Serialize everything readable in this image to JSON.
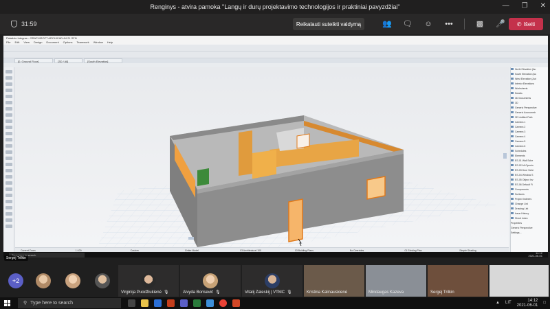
{
  "window": {
    "title": "Renginys - atvira pamoka \"Langų ir durų projektavimo technologijos ir praktiniai pavyzdžiai\""
  },
  "meeting": {
    "timer": "31:59",
    "request_control_label": "Reikalauti suteikti valdymą",
    "leave_label": "Išeiti"
  },
  "archicad": {
    "title": "Paladzio Integras - GRAPHISOFT ARCHICAD-64 21 SFN",
    "menu": [
      "File",
      "Edit",
      "View",
      "Design",
      "Document",
      "Options",
      "Teamwork",
      "Window",
      "Help"
    ],
    "tabs": [
      "[0. Ground Floor]",
      "[3D / All]",
      "[South Elevation]"
    ],
    "navigator": [
      "North Elevation (Au",
      "South Elevation (Au",
      "West Elevation (Aut",
      "Interior Elevations",
      "Worksheets",
      "Details",
      "3D Documents",
      "3D",
      "Generic Perspective",
      "Generic Axonometr",
      "3D Untitled Path",
      "Camera 1",
      "Camera 2",
      "Camera 3",
      "Camera 4",
      "Camera 5",
      "Camera 6",
      "Schedules",
      "Elements",
      "ES-01 Wall Sche",
      "ES-02 All Openin",
      "ES-03 Door Sche",
      "ES-04 Window S",
      "ES-05 Object Inv",
      "ES-06 Default Fi",
      "Components",
      "Surfaces",
      "Project Indexes",
      "Change List",
      "Drawing List",
      "Issue History",
      "Sheet Index",
      "Properties",
      "Generic Perspective",
      "Settings..."
    ],
    "status_bar": [
      "Current Zoom",
      "1:100",
      "Custom",
      "Entire Model",
      "03 Architectural 100",
      "03 Building Plans",
      "No Overrides",
      "01 Existing Plan",
      "Simple Shading"
    ],
    "presenter_label": "Sergej Trilkin",
    "inner_taskbar_search": "Type here to search",
    "inner_clock": "14:12",
    "inner_date": "2021-06-01"
  },
  "participants": {
    "more_count": "+2",
    "tiles": [
      {
        "name": "Virginija Puodžiukienė"
      },
      {
        "name": "Alvyda Borisevič"
      },
      {
        "name": "Vitalij Zaleskij | VTMC"
      },
      {
        "name": "Kristina Kalinauskienė"
      },
      {
        "name": "Mindaugas Kazeva"
      },
      {
        "name": "Sergej Trilkin"
      },
      {
        "name": ""
      }
    ]
  },
  "taskbar": {
    "search_placeholder": "Type here to search",
    "clock": "14:12",
    "date": "2021-06-01",
    "lang": "LIT"
  }
}
